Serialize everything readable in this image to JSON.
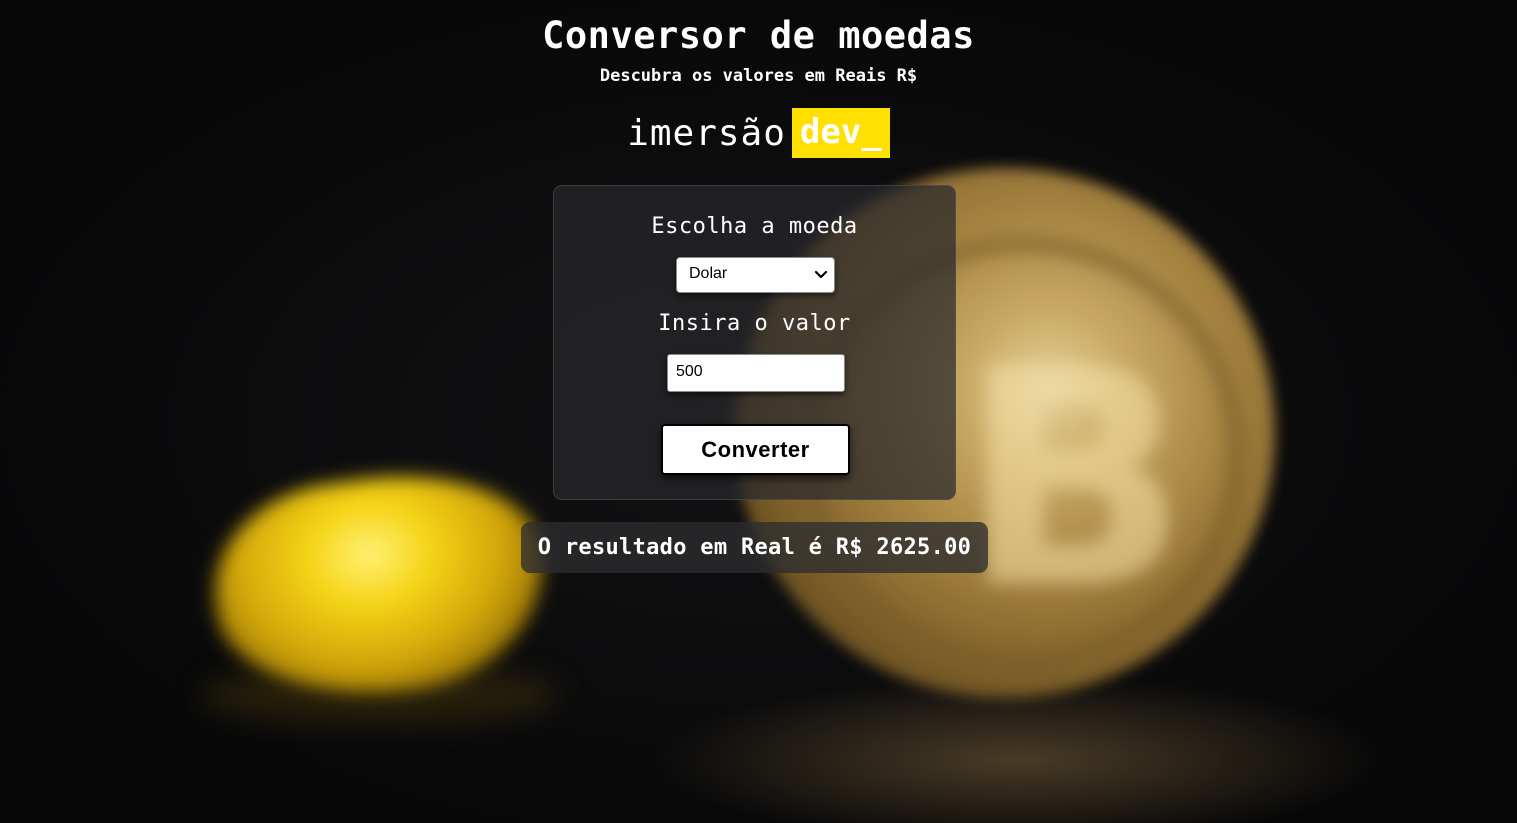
{
  "header": {
    "title": "Conversor de moedas",
    "subtitle": "Descubra os valores em Reais R$"
  },
  "brand": {
    "word": "imersão",
    "tag": "dev_",
    "tag_color": "#ffe000"
  },
  "form": {
    "currency_label": "Escolha a moeda",
    "currency_selected": "Dolar",
    "value_label": "Insira o valor",
    "value_input": "500",
    "convert_button": "Converter"
  },
  "result": {
    "text": "O resultado em Real é R$ 2625.00"
  },
  "icons": {
    "select_arrow": "chevron-down-icon"
  },
  "colors": {
    "background": "#0b0b0c",
    "accent": "#ffe000",
    "text": "#ffffff"
  }
}
